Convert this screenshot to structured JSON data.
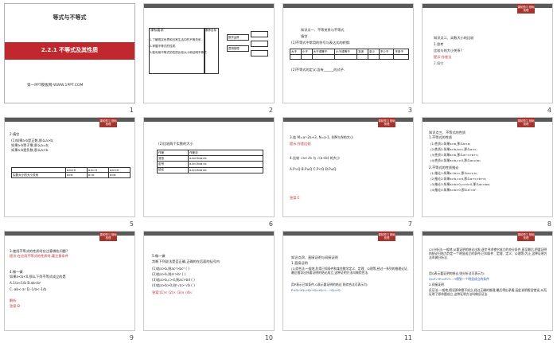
{
  "slides": [
    {
      "num": "1",
      "title": "等式与不等式",
      "subtitle": "2.2.1 不等式及其性质",
      "site": "第一PPT模板网-WWW.1PPT.COM"
    },
    {
      "num": "2",
      "col1": "课标要求",
      "col2": "素养目标",
      "items": [
        "1.了解现实世界和日常生活中的不等关系.",
        "2.掌握不等式的性质.",
        "3.能利用不等式的性质比较大小和证明不等式."
      ],
      "right": [
        "数学运算",
        "逻辑推理"
      ]
    },
    {
      "num": "3",
      "lines": [
        "知识点一、不等关系与不等式",
        "填空",
        "(1)不等式中常用的符号与表达式的转换:"
      ],
      "headers": [
        "大于",
        "小于",
        "大于或等于",
        "小于或等于",
        "至多",
        "至少",
        "不少于",
        "不多于"
      ],
      "note": "(2)不等式的定义:含有______的式子."
    },
    {
      "num": "4",
      "badge": "课前预习 基础梳理",
      "lines": [
        "知识点二、实数大小的比较",
        "1.思考",
        "比较与的大小关系?",
        "提示:作差法",
        "2.填空"
      ]
    },
    {
      "num": "5",
      "badge": "课前预习 基础梳理",
      "lines": [
        "2.填空",
        "(1)如果a-b是正数,那么a>b;",
        "如果a-b等于零,那么a=b;",
        "如果a-b是负数,那么a<b."
      ],
      "t_headers": [
        "",
        "a-b>0",
        "a-b=0",
        "a-b<0"
      ],
      "t_row": [
        "实数大小的大小关系",
        "a>b",
        "a=b",
        "a<b"
      ]
    },
    {
      "num": "6",
      "lines": [
        "(2)比较两个实数的大小"
      ],
      "rows": [
        [
          "作差",
          "作差法"
        ],
        [
          "变形",
          "a-b>0⇔a>b"
        ],
        [
          "定号",
          "a-b=0⇔a=b"
        ],
        [
          "结论",
          "a-b<0⇔a<b"
        ]
      ]
    },
    {
      "num": "7",
      "badge": "课前预习 基础梳理",
      "lines": [
        "3.若 M=a²-2a+3, N=a-1, 则M与N的大小",
        "提示:作差比较",
        "4.比较 √a+√b 与 √(a+b) 的大小",
        "A.P>Q  B.P≥Q  C.P<Q  D.P≤Q",
        "答案:C"
      ]
    },
    {
      "num": "8",
      "badge": "课前预习 基础梳理",
      "lines": [
        "知识点三、不等式的性质",
        "1.不等式的性质",
        "(1)性质1:如果a>b,那么b<a;",
        "(2)性质2:如果a>b,b>c,那么a>c;",
        "(3)性质3:如果a>b,那么a+c>b+c;",
        "(4)性质4:如果a>b,c>0,那么ac>bc;",
        "2.不等式的性质推论",
        "(1)推论1:如果a+b>c,那么a>c-b;",
        "(2)推论2:如果a>b,c>d,那么a+c>b+d;",
        "(3)推论3:如果a>b>0,c>d>0,那么ac>bd;",
        "(4)推论4:如果a>b>0,那么aⁿ>bⁿ."
      ]
    },
    {
      "num": "9",
      "badge": "课前预习 基础梳理",
      "lines": [
        "3.使用不等式的性质时应注意哪些问题?",
        "提示:在应用不等式的性质时,要注意条件",
        "4.做一做",
        "如果a<b<0,那么下列不等式成立的是",
        "A.1/a<1/b  B.ab<b²",
        "C.-ab<-a²  D.-1/a<-1/b",
        "解析:",
        "答案:D"
      ]
    },
    {
      "num": "10",
      "lines": [
        "5.做一做",
        "判断下列说法是否正确,正确的在后面的括号内",
        "(1)若a>b,则ac²>bc² (  )",
        "(2)若a>b,则a²>b² (  )",
        "(3)若a>b,c>d,则ac>bd (  )",
        "(4)若a>b>0,则ⁿ√a>ⁿ√b (  )",
        "答案:(1)× (2)× (3)× (4)√"
      ]
    },
    {
      "num": "11",
      "badge": "课前预习 基础梳理",
      "lines": [
        "知识点四、直接证明与间接证明",
        "1.直接证明",
        "(1)综合法:一般地,利用已知条件和某些数学定义、定理、公理等,经过一系列的推理论证,最后推导出所要证明的结论成立,这种证明方法叫做综合法.",
        "用P表示已知条件,Q表示要证明的结论,则综合法可表示为:",
        "P⇒Q₁→Q₁⇒Q₂→Q₂⇒Q₃→…→Qₙ⇒Q"
      ]
    },
    {
      "num": "12",
      "badge": "课前预习 基础梳理",
      "lines": [
        "(2)分析法:一般地,从要证明的结论出发,逐步寻求使它成立的充分条件,直至最后,把要证明的结论归结为判定一个明显成立的条件(已知条件、定理、定义、公理等)为止,这种证明方法叫做分析法.",
        "用Q表示要证明的结论,则分析法可表示为:",
        "Q⇐P₁→P₁⇐P₂→…→得到一个明显成立的条件",
        "2.间接证明",
        "反证法:一般地,假设原命题不成立,经过正确的推理,最后得出矛盾,因此说明假设错误,从而证明了原命题成立,这种证明方法叫做反证法."
      ]
    }
  ]
}
